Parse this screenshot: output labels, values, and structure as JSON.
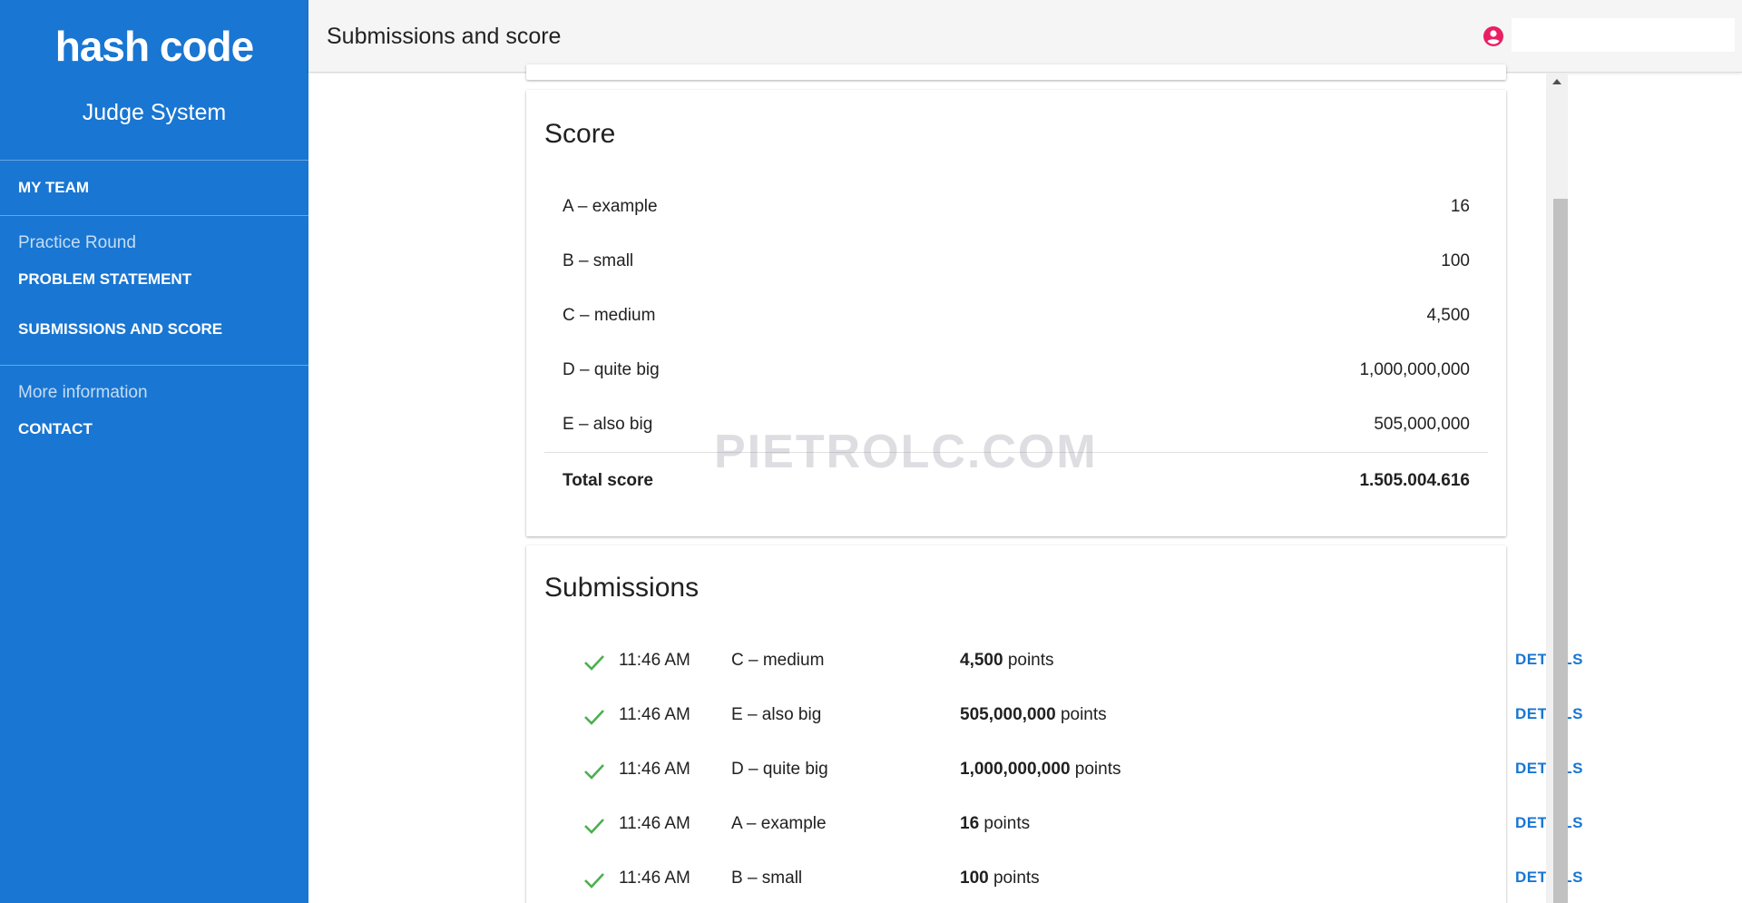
{
  "sidebar": {
    "logo": "hash code",
    "subtitle": "Judge System",
    "nav": {
      "my_team": "MY TEAM",
      "section_practice": "Practice Round",
      "problem_statement": "PROBLEM STATEMENT",
      "submissions_and_score": "SUBMISSIONS AND SCORE",
      "section_more": "More information",
      "contact": "CONTACT"
    }
  },
  "header": {
    "title": "Submissions and score",
    "account_icon": "account-circle-icon"
  },
  "score": {
    "title": "Score",
    "rows": [
      {
        "label": "A – example",
        "value": "16"
      },
      {
        "label": "B – small",
        "value": "100"
      },
      {
        "label": "C – medium",
        "value": "4,500"
      },
      {
        "label": "D – quite big",
        "value": "1,000,000,000"
      },
      {
        "label": "E – also big",
        "value": "505,000,000"
      }
    ],
    "total_label": "Total score",
    "total_value": "1.505.004.616"
  },
  "submissions": {
    "title": "Submissions",
    "points_suffix": "points",
    "details_label": "DETAILS",
    "status_icon": "check-icon",
    "rows": [
      {
        "time": "11:46 AM",
        "name": "C – medium",
        "points": "4,500"
      },
      {
        "time": "11:46 AM",
        "name": "E – also big",
        "points": "505,000,000"
      },
      {
        "time": "11:46 AM",
        "name": "D – quite big",
        "points": "1,000,000,000"
      },
      {
        "time": "11:46 AM",
        "name": "A – example",
        "points": "16"
      },
      {
        "time": "11:46 AM",
        "name": "B – small",
        "points": "100"
      }
    ]
  },
  "watermark": "PIETROLC.COM",
  "colors": {
    "primary": "#1976d2",
    "check": "#4caf50",
    "account": "#e91e63"
  }
}
